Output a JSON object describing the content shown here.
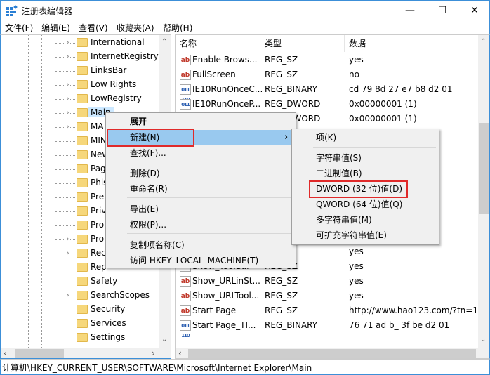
{
  "window": {
    "title": "注册表编辑器",
    "minimize": "—",
    "maximize": "☐",
    "close": "✕"
  },
  "menubar": [
    "文件(F)",
    "编辑(E)",
    "查看(V)",
    "收藏夹(A)",
    "帮助(H)"
  ],
  "tree": {
    "items": [
      {
        "label": "International",
        "chevron": true
      },
      {
        "label": "InternetRegistry",
        "chevron": true
      },
      {
        "label": "LinksBar",
        "chevron": false
      },
      {
        "label": "Low Rights",
        "chevron": true
      },
      {
        "label": "LowRegistry",
        "chevron": true
      },
      {
        "label": "Main",
        "chevron": true,
        "selected": true
      },
      {
        "label": "MA",
        "chevron": true
      },
      {
        "label": "MIN",
        "chevron": false
      },
      {
        "label": "New",
        "chevron": false
      },
      {
        "label": "Pag",
        "chevron": false
      },
      {
        "label": "Phis",
        "chevron": false
      },
      {
        "label": "Pref",
        "chevron": false
      },
      {
        "label": "Priv",
        "chevron": false
      },
      {
        "label": "Prot",
        "chevron": false
      },
      {
        "label": "Prot",
        "chevron": true
      },
      {
        "label": "Rec",
        "chevron": true
      },
      {
        "label": "Rep",
        "chevron": false
      },
      {
        "label": "Safety",
        "chevron": false
      },
      {
        "label": "SearchScopes",
        "chevron": true
      },
      {
        "label": "Security",
        "chevron": false
      },
      {
        "label": "Services",
        "chevron": false
      },
      {
        "label": "Settings",
        "chevron": false
      }
    ]
  },
  "list": {
    "headers": [
      "名称",
      "类型",
      "数据"
    ],
    "rows": [
      {
        "icon": "string-value-icon",
        "name": "Enable Brows...",
        "type": "REG_SZ",
        "data": "yes"
      },
      {
        "icon": "string-value-icon",
        "name": "FullScreen",
        "type": "REG_SZ",
        "data": "no"
      },
      {
        "icon": "binary-value-icon",
        "name": "IE10RunOnceC...",
        "type": "REG_BINARY",
        "data": "cd 79 8d 27 e7 b8 d2 01"
      },
      {
        "icon": "binary-value-icon",
        "name": "IE10RunOnceP...",
        "type": "REG_DWORD",
        "data": "0x00000001 (1)"
      },
      {
        "icon": "",
        "name": "",
        "type": "REG_DWORD",
        "data": "0x00000001 (1)"
      },
      {
        "icon": "",
        "name": "",
        "type": "",
        "data": "01"
      },
      {
        "icon": "",
        "name": "",
        "type": "",
        "data": ""
      },
      {
        "icon": "",
        "name": "",
        "type": "",
        "data": ""
      },
      {
        "icon": "",
        "name": "",
        "type": "",
        "data": ""
      },
      {
        "icon": "",
        "name": "",
        "type": "",
        "data": ""
      },
      {
        "icon": "",
        "name": "",
        "type": "",
        "data": ""
      },
      {
        "icon": "",
        "name": "",
        "type": "",
        "data": "m/fwlink/"
      },
      {
        "icon": "",
        "name": "",
        "type": "",
        "data": "no"
      },
      {
        "icon": "",
        "name": "",
        "type": "",
        "data": "yes"
      },
      {
        "icon": "string-value-icon",
        "name": "Show_ToolBar",
        "type": "REG_SZ",
        "data": "yes"
      },
      {
        "icon": "string-value-icon",
        "name": "Show_URLinSt...",
        "type": "REG_SZ",
        "data": "yes"
      },
      {
        "icon": "string-value-icon",
        "name": "Show_URLTool...",
        "type": "REG_SZ",
        "data": "yes"
      },
      {
        "icon": "string-value-icon",
        "name": "Start Page",
        "type": "REG_SZ",
        "data": "http://www.hao123.com/?tn=12"
      },
      {
        "icon": "binary-value-icon",
        "name": "Start Page_TI...",
        "type": "REG_BINARY",
        "data": "76 71 ad b_ 3f be d2 01"
      }
    ]
  },
  "context_menu": {
    "items": [
      "展开",
      "新建(N)",
      "查找(F)...",
      "删除(D)",
      "重命名(R)",
      "导出(E)",
      "权限(P)...",
      "复制项名称(C)",
      "访问 HKEY_LOCAL_MACHINE(T)"
    ],
    "highlighted": "新建(N)",
    "submenu_arrow": "›"
  },
  "submenu": {
    "items": [
      "项(K)",
      "字符串值(S)",
      "二进制值(B)",
      "DWORD (32 位)值(D)",
      "QWORD (64 位)值(Q)",
      "多字符串值(M)",
      "可扩充字符串值(E)"
    ],
    "highlighted_box": "DWORD (32 位)值(D)"
  },
  "status": "计算机\\HKEY_CURRENT_USER\\SOFTWARE\\Microsoft\\Internet Explorer\\Main",
  "colors": {
    "highlight": "#99c9ef",
    "annotation_red": "#e02a2a",
    "window_border": "#3c8fd8"
  }
}
